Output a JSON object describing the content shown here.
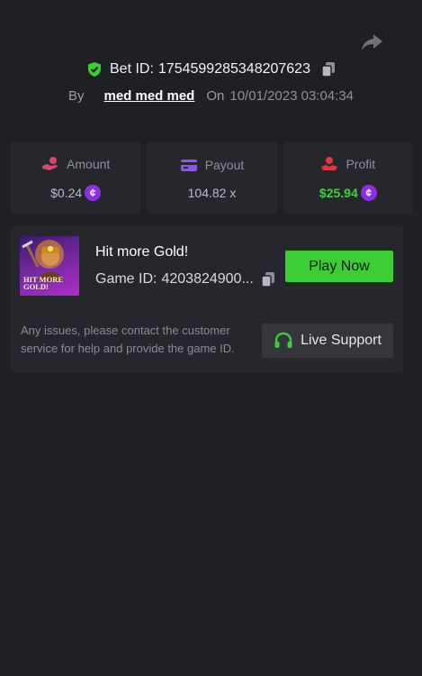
{
  "bet": {
    "label": "Bet ID:",
    "id": "1754599285348207623",
    "by_label": "By",
    "user": "med med med",
    "on_label": "On",
    "datetime": "10/01/2023 03:04:34"
  },
  "stats": [
    {
      "label": "Amount",
      "value": "$0.24",
      "icon": "hand-coins-icon",
      "coin": true
    },
    {
      "label": "Payout",
      "value": "104.82 x",
      "icon": "card-icon",
      "coin": false
    },
    {
      "label": "Profit",
      "value": "$25.94",
      "icon": "hand-money-icon",
      "coin": true
    }
  ],
  "game": {
    "title": "Hit more Gold!",
    "id_label": "Game ID:",
    "id_value": "4203824900...",
    "thumbnail_text": "HIT MORE GOLD!",
    "play_label": "Play Now"
  },
  "support": {
    "notice": "Any issues, please contact the customer service for help and provide the game ID.",
    "button_label": "Live Support"
  },
  "colors": {
    "background": "#1f2024",
    "card": "#26272c",
    "accent_green": "#3ccc33",
    "coin_purple": "#8c2ee6",
    "amount_icon": "#e0456f",
    "payout_icon": "#8a55f0",
    "profit_icon": "#e5323f"
  }
}
